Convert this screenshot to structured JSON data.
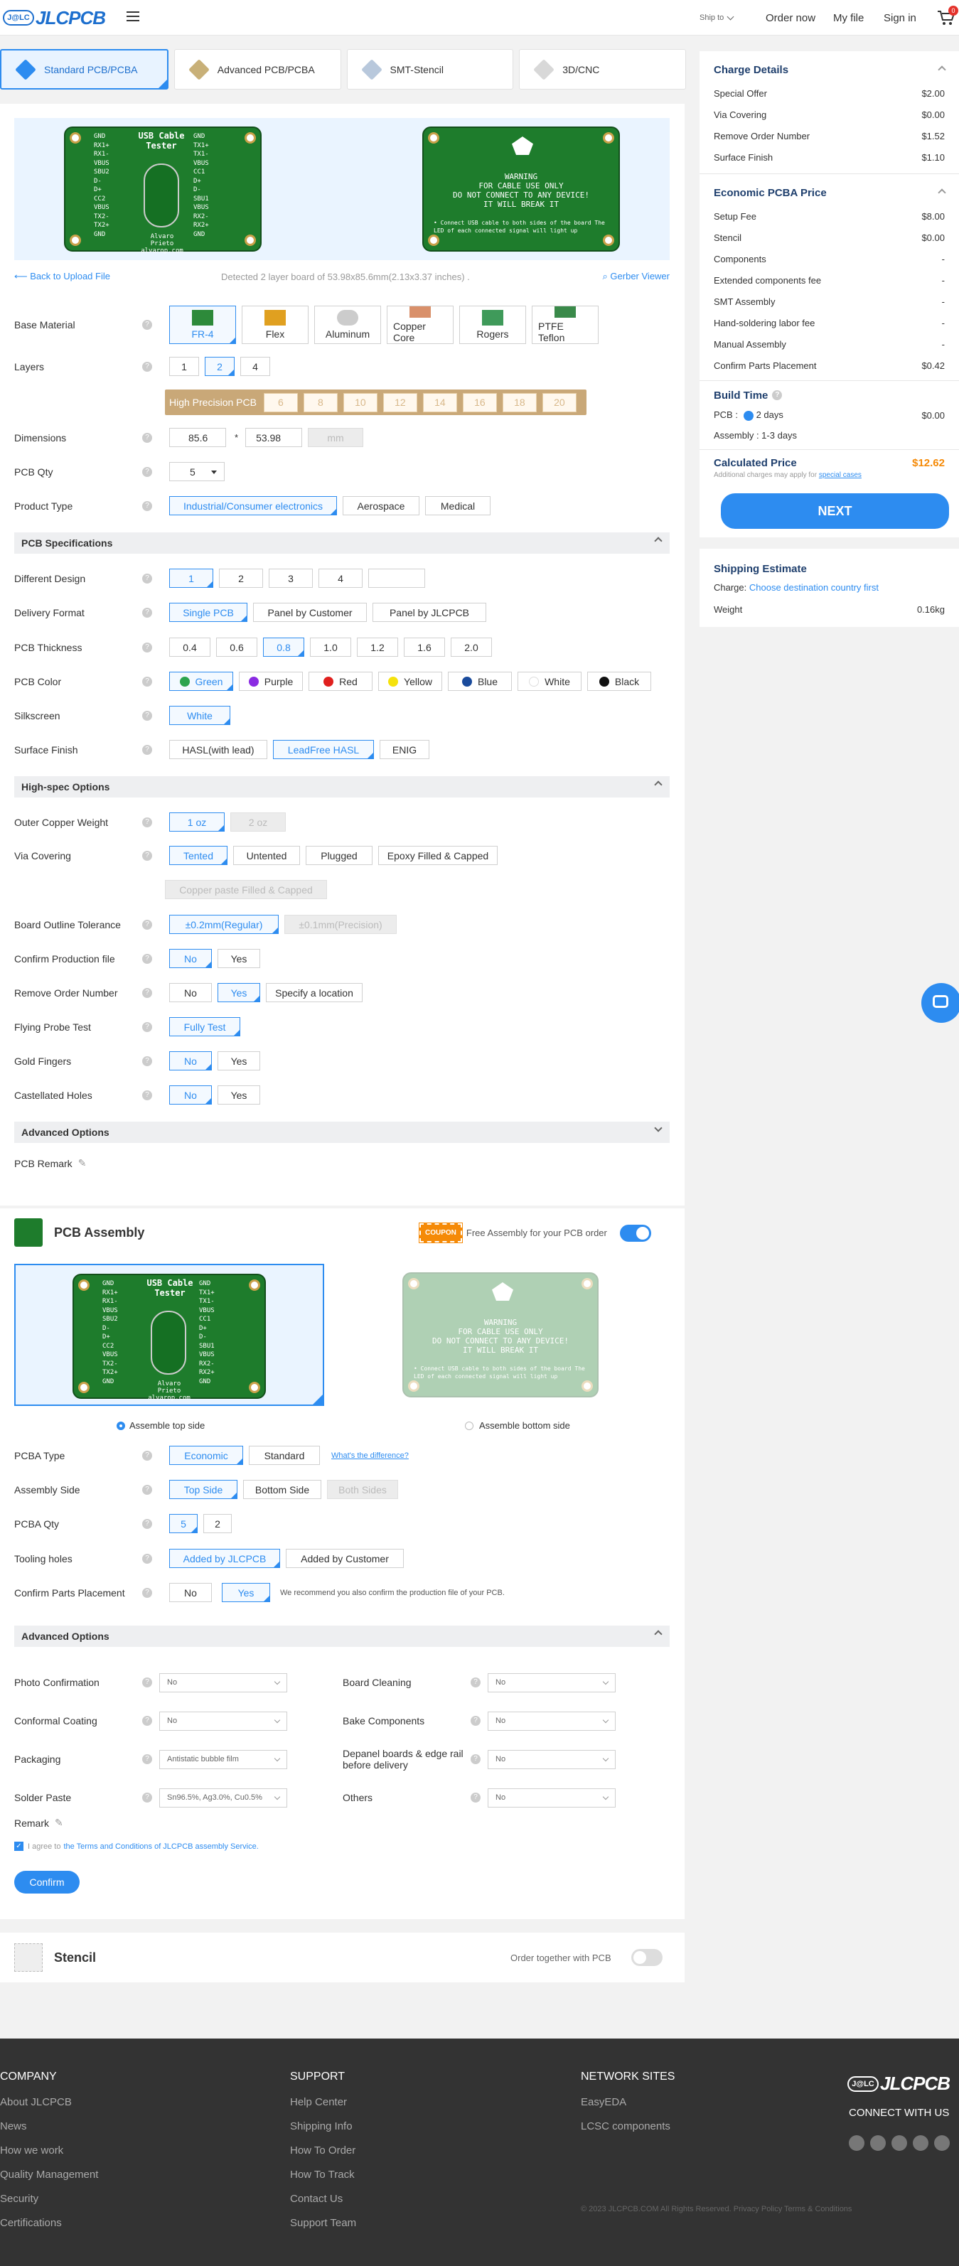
{
  "header": {
    "logo_badge": "J@LC",
    "logo_text": "JLCPCB",
    "ship_to": "Ship to",
    "order_now": "Order now",
    "my_file": "My file",
    "sign_in": "Sign in",
    "cart_count": "0"
  },
  "tabs": [
    "Standard PCB/PCBA",
    "Advanced PCB/PCBA",
    "SMT-Stencil",
    "3D/CNC"
  ],
  "board": {
    "title": "USB Cable Tester",
    "left_pins": [
      "GND",
      "RX1+",
      "RX1-",
      "VBUS",
      "SBU2",
      "D-",
      "D+",
      "CC2",
      "VBUS",
      "TX2-",
      "TX2+",
      "GND"
    ],
    "right_pins": [
      "GND",
      "TX1+",
      "TX1-",
      "VBUS",
      "CC1",
      "D+",
      "D-",
      "SBU1",
      "VBUS",
      "RX2-",
      "RX2+",
      "GND"
    ],
    "credit": "Alvaro Prieto",
    "url": "alvarop.com",
    "warning": [
      "WARNING",
      "FOR CABLE USE ONLY",
      "DO NOT CONNECT TO ANY DEVICE!",
      "IT WILL BREAK IT"
    ],
    "note": "• Connect USB cable to both sides of the board  The LED of each connected signal will light up"
  },
  "upload": {
    "back": "Back to Upload File",
    "detected": "Detected 2 layer board of 53.98x85.6mm(2.13x3.37 inches) .",
    "gerber": "Gerber Viewer"
  },
  "pcb": {
    "base_material": {
      "label": "Base Material",
      "options": [
        "FR-4",
        "Flex",
        "Aluminum",
        "Copper Core",
        "Rogers",
        "PTFE Teflon"
      ]
    },
    "layers": {
      "label": "Layers",
      "options": [
        "1",
        "2",
        "4"
      ],
      "hp_label": "High Precision PCB",
      "hp_options": [
        "6",
        "8",
        "10",
        "12",
        "14",
        "16",
        "18",
        "20"
      ]
    },
    "dimensions": {
      "label": "Dimensions",
      "x": "85.6",
      "sep": "*",
      "y": "53.98",
      "unit": "mm"
    },
    "qty": {
      "label": "PCB Qty",
      "value": "5"
    },
    "product_type": {
      "label": "Product Type",
      "options": [
        "Industrial/Consumer electronics",
        "Aerospace",
        "Medical"
      ]
    }
  },
  "spec": {
    "title": "PCB Specifications",
    "different_design": {
      "label": "Different Design",
      "options": [
        "1",
        "2",
        "3",
        "4",
        ""
      ]
    },
    "delivery_format": {
      "label": "Delivery Format",
      "options": [
        "Single PCB",
        "Panel by Customer",
        "Panel by JLCPCB"
      ]
    },
    "thickness": {
      "label": "PCB Thickness",
      "options": [
        "0.4",
        "0.6",
        "0.8",
        "1.0",
        "1.2",
        "1.6",
        "2.0"
      ]
    },
    "color": {
      "label": "PCB Color",
      "options": [
        {
          "name": "Green",
          "color": "#2da44e"
        },
        {
          "name": "Purple",
          "color": "#8a2be2"
        },
        {
          "name": "Red",
          "color": "#e0201e"
        },
        {
          "name": "Yellow",
          "color": "#f5e20c"
        },
        {
          "name": "Blue",
          "color": "#1a4b9c"
        },
        {
          "name": "White",
          "color": "#ffffff"
        },
        {
          "name": "Black",
          "color": "#111111"
        }
      ]
    },
    "silkscreen": {
      "label": "Silkscreen",
      "value": "White"
    },
    "surface": {
      "label": "Surface Finish",
      "options": [
        "HASL(with lead)",
        "LeadFree HASL",
        "ENIG"
      ]
    }
  },
  "highspec": {
    "title": "High-spec Options",
    "copper": {
      "label": "Outer Copper Weight",
      "options": [
        "1 oz",
        "2 oz"
      ]
    },
    "via": {
      "label": "Via Covering",
      "options": [
        "Tented",
        "Untented",
        "Plugged",
        "Epoxy Filled & Capped",
        "Copper paste Filled & Capped"
      ]
    },
    "tolerance": {
      "label": "Board Outline Tolerance",
      "options": [
        "±0.2mm(Regular)",
        "±0.1mm(Precision)"
      ]
    },
    "confirm": {
      "label": "Confirm Production file",
      "options": [
        "No",
        "Yes"
      ]
    },
    "remove": {
      "label": "Remove Order Number",
      "options": [
        "No",
        "Yes",
        "Specify a location"
      ]
    },
    "probe": {
      "label": "Flying Probe Test",
      "value": "Fully Test"
    },
    "gold": {
      "label": "Gold Fingers",
      "options": [
        "No",
        "Yes"
      ]
    },
    "castellated": {
      "label": "Castellated Holes",
      "options": [
        "No",
        "Yes"
      ]
    }
  },
  "advanced": {
    "title": "Advanced Options",
    "remark": "PCB Remark"
  },
  "assembly": {
    "title": "PCB Assembly",
    "coupon": "COUPON",
    "coupon_text": "Free Assembly for your PCB order",
    "top": "Assemble top side",
    "bottom": "Assemble bottom side",
    "type": {
      "label": "PCBA Type",
      "options": [
        "Economic",
        "Standard"
      ],
      "link": "What's the difference?"
    },
    "side": {
      "label": "Assembly Side",
      "options": [
        "Top Side",
        "Bottom Side",
        "Both Sides"
      ]
    },
    "qty": {
      "label": "PCBA Qty",
      "options": [
        "5",
        "2"
      ]
    },
    "tooling": {
      "label": "Tooling holes",
      "options": [
        "Added by JLCPCB",
        "Added by Customer"
      ]
    },
    "confirm": {
      "label": "Confirm Parts Placement",
      "options": [
        "No",
        "Yes"
      ],
      "note": "We recommend you also confirm the production file of your PCB."
    },
    "adv_title": "Advanced Options",
    "adv_left": [
      {
        "label": "Photo Confirmation",
        "value": "No"
      },
      {
        "label": "Conformal Coating",
        "value": "No"
      },
      {
        "label": "Packaging",
        "value": "Antistatic bubble film"
      },
      {
        "label": "Solder Paste",
        "value": "Sn96.5%, Ag3.0%, Cu0.5%"
      }
    ],
    "adv_right": [
      {
        "label": "Board Cleaning",
        "value": "No"
      },
      {
        "label": "Bake Components",
        "value": "No"
      },
      {
        "label": "Depanel boards & edge rail before delivery",
        "value": "No"
      },
      {
        "label": "Others",
        "value": "No"
      }
    ],
    "remark": "Remark",
    "agree_pre": "I agree to",
    "agree_link": "the Terms and Conditions of JLCPCB assembly Service.",
    "confirm_btn": "Confirm"
  },
  "stencil": {
    "title": "Stencil",
    "order_together": "Order together with PCB"
  },
  "charge": {
    "title": "Charge Details",
    "items": [
      {
        "label": "Special Offer",
        "value": "$2.00"
      },
      {
        "label": "Via Covering",
        "value": "$0.00"
      },
      {
        "label": "Remove Order Number",
        "value": "$1.52"
      },
      {
        "label": "Surface Finish",
        "value": "$1.10"
      }
    ],
    "pcba_title": "Economic PCBA Price",
    "pcba_items": [
      {
        "label": "Setup Fee",
        "value": "$8.00"
      },
      {
        "label": "Stencil",
        "value": "$0.00"
      },
      {
        "label": "Components",
        "value": "-"
      },
      {
        "label": "Extended components fee",
        "value": "-"
      },
      {
        "label": "SMT Assembly",
        "value": "-"
      },
      {
        "label": "Hand-soldering labor fee",
        "value": "-"
      },
      {
        "label": "Manual Assembly",
        "value": "-"
      },
      {
        "label": "Confirm Parts Placement",
        "value": "$0.42"
      }
    ],
    "build_time": "Build Time",
    "pcb_label": "PCB :",
    "pcb_time": "2 days",
    "pcb_price": "$0.00",
    "assembly_time": "Assembly : 1-3 days",
    "calc_label": "Calculated Price",
    "calc_value": "$12.62",
    "calc_note": "Additional charges may apply for",
    "calc_link": "special cases",
    "next": "NEXT"
  },
  "shipping": {
    "title": "Shipping Estimate",
    "charge_label": "Charge:",
    "charge_link": "Choose destination country first",
    "weight_label": "Weight",
    "weight_value": "0.16kg"
  },
  "footer": {
    "company": {
      "title": "COMPANY",
      "links": [
        "About JLCPCB",
        "News",
        "How we work",
        "Quality Management",
        "Security",
        "Certifications"
      ]
    },
    "support": {
      "title": "SUPPORT",
      "links": [
        "Help Center",
        "Shipping Info",
        "How To Order",
        "How To Track",
        "Contact Us",
        "Support Team"
      ]
    },
    "network": {
      "title": "NETWORK SITES",
      "links": [
        "EasyEDA",
        "LCSC components"
      ]
    },
    "connect": "CONNECT WITH US",
    "copyright": "© 2023 JLCPCB.COM All Rights Reserved. Privacy Policy Terms & Conditions"
  }
}
